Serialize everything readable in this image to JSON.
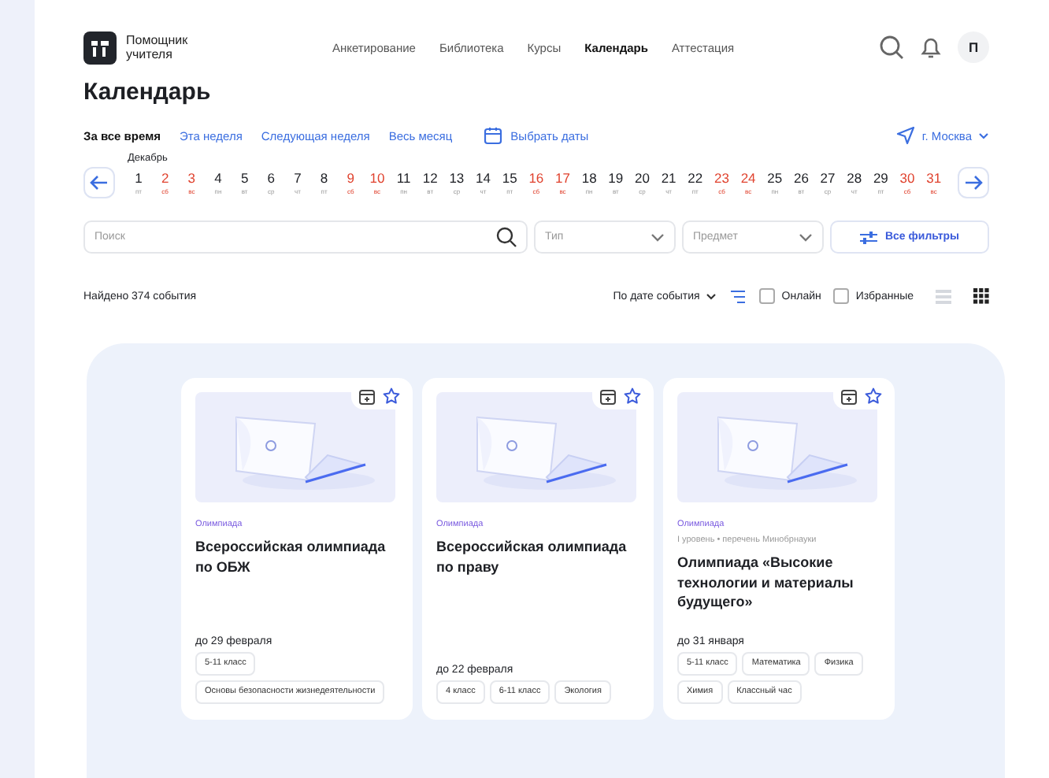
{
  "header": {
    "logo_text": "Помощник учителя",
    "nav": [
      {
        "label": "Анкетирование",
        "selected": false
      },
      {
        "label": "Библиотека",
        "selected": false
      },
      {
        "label": "Курсы",
        "selected": false
      },
      {
        "label": "Календарь",
        "selected": true
      },
      {
        "label": "Аттестация",
        "selected": false
      }
    ],
    "avatar": "П"
  },
  "page_title": "Календарь",
  "periods": [
    {
      "label": "За все время",
      "selected": true
    },
    {
      "label": "Эта неделя",
      "selected": false
    },
    {
      "label": "Следующая неделя",
      "selected": false
    },
    {
      "label": "Весь месяц",
      "selected": false
    }
  ],
  "pick_dates": "Выбрать даты",
  "city": "г. Москва",
  "month": "Декабрь",
  "days": [
    {
      "day": "1",
      "weekday": "пт",
      "weekend": false
    },
    {
      "day": "2",
      "weekday": "сб",
      "weekend": true
    },
    {
      "day": "3",
      "weekday": "вс",
      "weekend": true
    },
    {
      "day": "4",
      "weekday": "пн",
      "weekend": false
    },
    {
      "day": "5",
      "weekday": "вт",
      "weekend": false
    },
    {
      "day": "6",
      "weekday": "ср",
      "weekend": false
    },
    {
      "day": "7",
      "weekday": "чт",
      "weekend": false
    },
    {
      "day": "8",
      "weekday": "пт",
      "weekend": false
    },
    {
      "day": "9",
      "weekday": "сб",
      "weekend": true
    },
    {
      "day": "10",
      "weekday": "вс",
      "weekend": true
    },
    {
      "day": "11",
      "weekday": "пн",
      "weekend": false
    },
    {
      "day": "12",
      "weekday": "вт",
      "weekend": false
    },
    {
      "day": "13",
      "weekday": "ср",
      "weekend": false
    },
    {
      "day": "14",
      "weekday": "чт",
      "weekend": false
    },
    {
      "day": "15",
      "weekday": "пт",
      "weekend": false
    },
    {
      "day": "16",
      "weekday": "сб",
      "weekend": true
    },
    {
      "day": "17",
      "weekday": "вс",
      "weekend": true
    },
    {
      "day": "18",
      "weekday": "пн",
      "weekend": false
    },
    {
      "day": "19",
      "weekday": "вт",
      "weekend": false
    },
    {
      "day": "20",
      "weekday": "ср",
      "weekend": false
    },
    {
      "day": "21",
      "weekday": "чт",
      "weekend": false
    },
    {
      "day": "22",
      "weekday": "пт",
      "weekend": false
    },
    {
      "day": "23",
      "weekday": "сб",
      "weekend": true
    },
    {
      "day": "24",
      "weekday": "вс",
      "weekend": true
    },
    {
      "day": "25",
      "weekday": "пн",
      "weekend": false
    },
    {
      "day": "26",
      "weekday": "вт",
      "weekend": false
    },
    {
      "day": "27",
      "weekday": "ср",
      "weekend": false
    },
    {
      "day": "28",
      "weekday": "чт",
      "weekend": false
    },
    {
      "day": "29",
      "weekday": "пт",
      "weekend": false
    },
    {
      "day": "30",
      "weekday": "сб",
      "weekend": true
    },
    {
      "day": "31",
      "weekday": "вс",
      "weekend": true
    }
  ],
  "filters": {
    "search": {
      "placeholder": "Поиск"
    },
    "type": {
      "placeholder": "Тип"
    },
    "subject": {
      "placeholder": "Предмет"
    },
    "all_filters": "Все фильтры"
  },
  "results": {
    "count": "Найдено 374 события",
    "sort": "По дате события",
    "online": {
      "label": "Онлайн",
      "checked": false
    },
    "favorites": {
      "label": "Избранные",
      "checked": false
    },
    "views": [
      {
        "kind": "list",
        "selected": false
      },
      {
        "kind": "grid",
        "selected": true
      }
    ]
  },
  "cards": [
    {
      "category": "Олимпиада",
      "title": "Всероссийская олимпиада по ОБЖ",
      "deadline": "до 29 февраля",
      "tags": [
        "5-11 класс",
        "Основы безопасности жизнедеятельности"
      ]
    },
    {
      "category": "Олимпиада",
      "title": "Всероссийская олимпиада по праву",
      "deadline": "до 22 февраля",
      "tags": [
        "4 класс",
        "6-11 класс",
        "Экология"
      ]
    },
    {
      "category": "Олимпиада",
      "subtitle": "I уровень • перечень Минобрнауки",
      "title": "Олимпиада «Высокие технологии и материалы будущего»",
      "deadline": "до 31 января",
      "tags": [
        "5-11 класс",
        "Математика",
        "Физика",
        "Химия",
        "Классный час"
      ]
    }
  ]
}
